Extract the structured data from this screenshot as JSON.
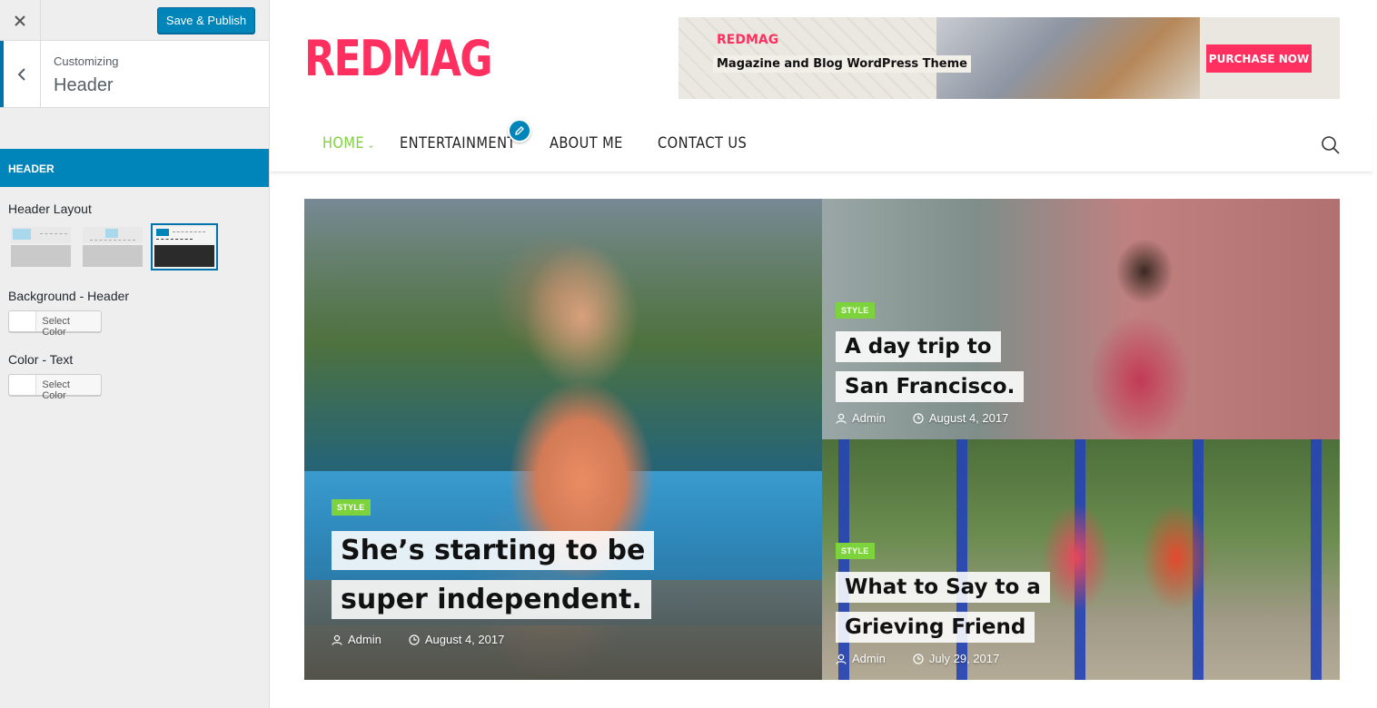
{
  "sidebar": {
    "publish_label": "Save & Publish",
    "action": "Customizing",
    "title": "Header",
    "section_title": "HEADER",
    "layout_label": "Header Layout",
    "bg_label": "Background - Header",
    "bg_button": "Select Color",
    "text_label": "Color - Text",
    "text_button": "Select Color"
  },
  "site": {
    "logo": "REDMAG",
    "banner": {
      "brand": "REDMAG",
      "tagline": "Magazine and Blog WordPress Theme",
      "cta": "PURCHASE NOW"
    },
    "nav": {
      "home": "HOME",
      "entertainment": "ENTERTAINMENT",
      "about": "ABOUT ME",
      "contact": "CONTACT US"
    }
  },
  "posts": [
    {
      "category": "STYLE",
      "title": "She’s starting to be super independent.",
      "author": "Admin",
      "date": "August 4, 2017"
    },
    {
      "category": "STYLE",
      "title": "A day trip to San Francisco.",
      "author": "Admin",
      "date": "August 4, 2017"
    },
    {
      "category": "STYLE",
      "title": "What to Say to a Grieving Friend",
      "author": "Admin",
      "date": "July 29, 2017"
    }
  ],
  "colors": {
    "brand": "#ff2f5f",
    "accent_green": "#7dd33b",
    "wp_blue": "#0085ba"
  }
}
